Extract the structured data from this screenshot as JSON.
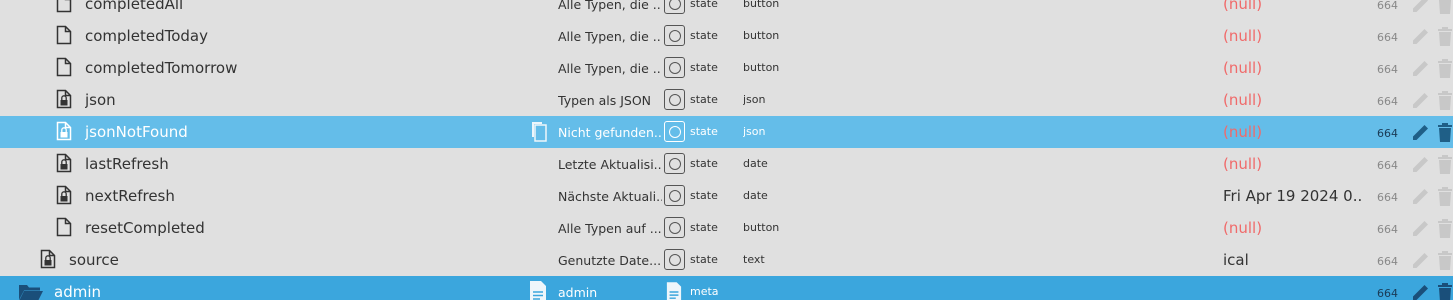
{
  "rows": [
    {
      "name": "completedAll",
      "desc": "Alle Typen, die ...",
      "type": "state",
      "role": "button",
      "value": "(null)",
      "acl": "664",
      "locked": false
    },
    {
      "name": "completedToday",
      "desc": "Alle Typen, die ...",
      "type": "state",
      "role": "button",
      "value": "(null)",
      "acl": "664",
      "locked": false
    },
    {
      "name": "completedTomorrow",
      "desc": "Alle Typen, die ...",
      "type": "state",
      "role": "button",
      "value": "(null)",
      "acl": "664",
      "locked": false
    },
    {
      "name": "json",
      "desc": "Typen als JSON",
      "type": "state",
      "role": "json",
      "value": "(null)",
      "acl": "664",
      "locked": true
    },
    {
      "name": "jsonNotFound",
      "desc": "Nicht gefunden...",
      "type": "state",
      "role": "json",
      "value": "(null)",
      "acl": "664",
      "locked": true,
      "selected": true
    },
    {
      "name": "lastRefresh",
      "desc": "Letzte Aktualisi...",
      "type": "state",
      "role": "date",
      "value": "(null)",
      "acl": "664",
      "locked": true
    },
    {
      "name": "nextRefresh",
      "desc": "Nächste Aktuali...",
      "type": "state",
      "role": "date",
      "value": "Fri Apr 19 2024 0...",
      "acl": "664",
      "locked": true
    },
    {
      "name": "resetCompleted",
      "desc": "Alle Typen auf ...",
      "type": "state",
      "role": "button",
      "value": "(null)",
      "acl": "664",
      "locked": false
    },
    {
      "name": "source",
      "desc": "Genutzte Date...",
      "type": "state",
      "role": "text",
      "value": "ical",
      "acl": "664",
      "locked": true
    }
  ],
  "folder": {
    "name": "admin",
    "desc": "admin",
    "type": "meta",
    "acl": "664"
  },
  "colors": {
    "selected": "#64bde9",
    "folder": "#3ba6dd",
    "null_value": "#f06a6a",
    "background": "#e0e0e0"
  }
}
